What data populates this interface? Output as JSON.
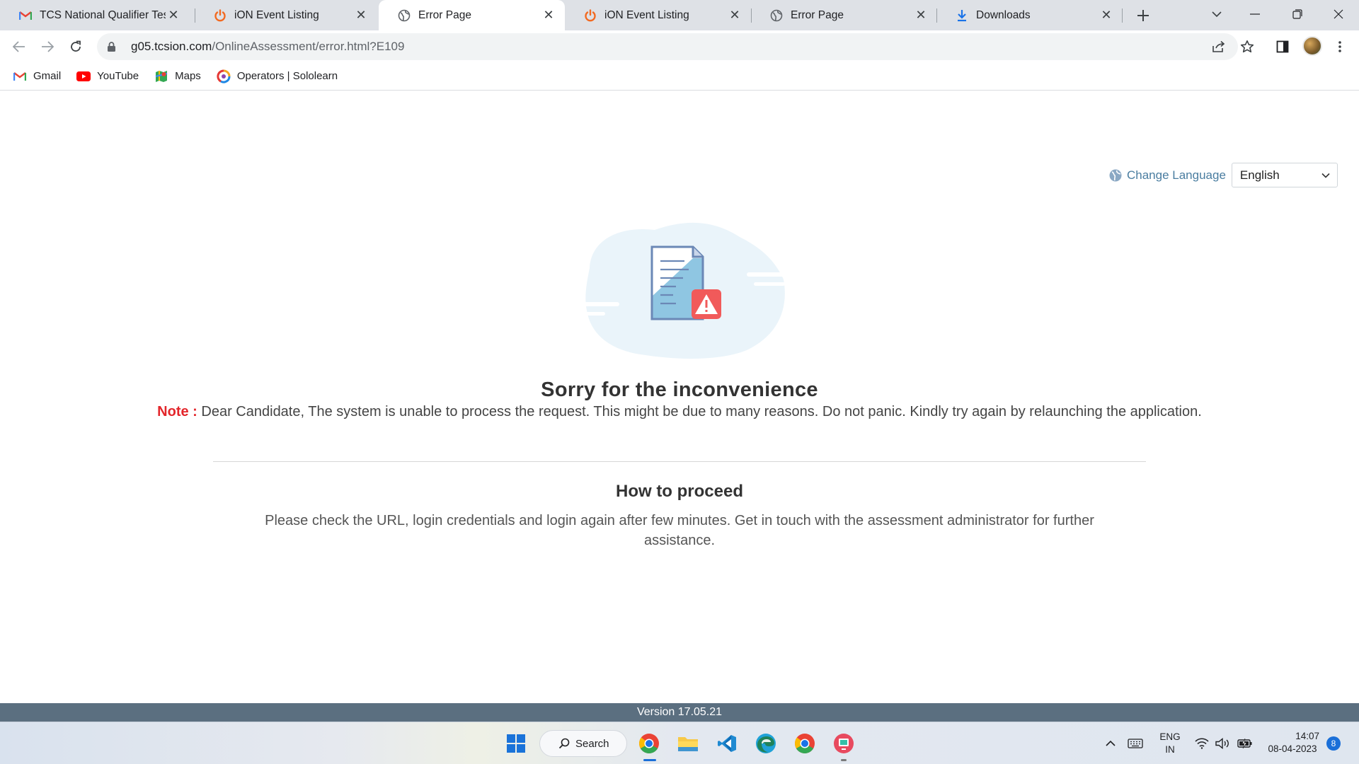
{
  "browser": {
    "tabs": [
      {
        "title": "TCS National Qualifier Test (",
        "icon": "gmail-icon",
        "active": false
      },
      {
        "title": "iON Event Listing",
        "icon": "power-icon",
        "active": false
      },
      {
        "title": "Error Page",
        "icon": "globe-icon",
        "active": true
      },
      {
        "title": "iON Event Listing",
        "icon": "power-icon",
        "active": false
      },
      {
        "title": "Error Page",
        "icon": "globe-icon",
        "active": false
      },
      {
        "title": "Downloads",
        "icon": "download-icon",
        "active": false
      }
    ],
    "url_domain": "g05.tcsion.com",
    "url_path": "/OnlineAssessment/error.html?E109",
    "bookmarks": [
      {
        "label": "Gmail",
        "icon": "gmail-icon"
      },
      {
        "label": "YouTube",
        "icon": "youtube-icon"
      },
      {
        "label": "Maps",
        "icon": "maps-icon"
      },
      {
        "label": "Operators | Sololearn",
        "icon": "sololearn-icon"
      }
    ]
  },
  "page": {
    "change_language_label": "Change Language",
    "language_selected": "English",
    "heading": "Sorry for the inconvenience",
    "note_label": "Note :",
    "note_text": " Dear Candidate, The system is unable to process the request. This might be due to many reasons. Do not panic. Kindly try again by relaunching the application.",
    "proceed_title": "How to proceed",
    "proceed_text": "Please check the URL, login credentials and login again after few minutes. Get in touch with the assessment administrator for further assistance.",
    "version": "Version 17.05.21"
  },
  "taskbar": {
    "search_label": "Search",
    "lang_line1": "ENG",
    "lang_line2": "IN",
    "time": "14:07",
    "date": "08-04-2023",
    "notification_count": "8"
  },
  "colors": {
    "note_red": "#e3262b",
    "link_blue": "#4a7da0",
    "version_bar": "#5b6f80",
    "tabstrip": "#dee1e6"
  }
}
